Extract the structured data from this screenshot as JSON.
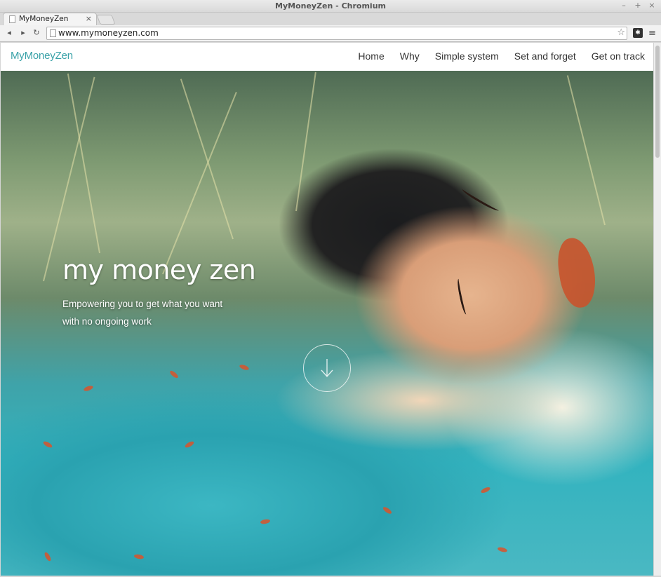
{
  "window": {
    "title": "MyMoneyZen - Chromium",
    "controls": [
      "–",
      "+",
      "×"
    ]
  },
  "tab": {
    "label": "MyMoneyZen",
    "close": "×"
  },
  "toolbar": {
    "back": "◂",
    "forward": "▸",
    "reload": "↻",
    "url": "www.mymoneyzen.com",
    "bookmark": "☆",
    "menu": "≡"
  },
  "site": {
    "brand": "MyMoneyZen",
    "nav": [
      "Home",
      "Why",
      "Simple system",
      "Set and forget",
      "Get on track"
    ]
  },
  "hero": {
    "title": "my money zen",
    "subtitle_line1": "Empowering you to get what you want",
    "subtitle_line2": "with no ongoing work"
  },
  "colors": {
    "brand": "#3aa2a8",
    "nav_text": "#333333",
    "hero_text": "#ffffff"
  },
  "icons": {
    "scroll_down": "arrow-down-icon"
  }
}
